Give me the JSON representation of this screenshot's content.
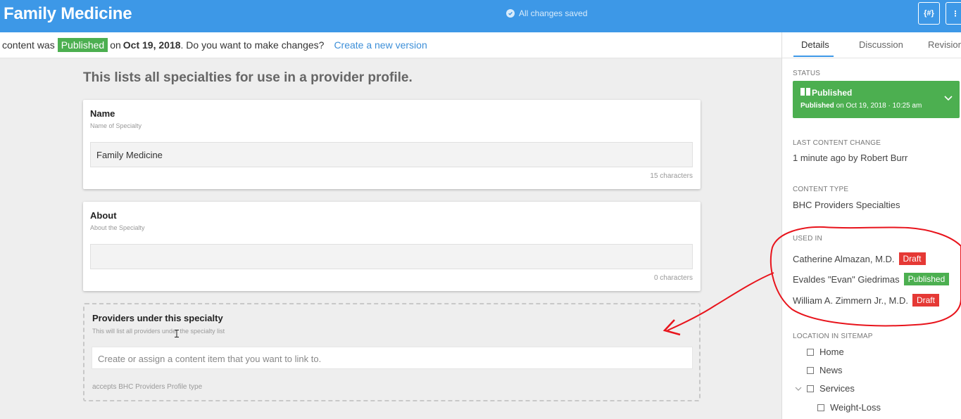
{
  "header": {
    "title": "Family Medicine",
    "save_status": "All changes saved",
    "code_button": "{#}",
    "more_button": "⋮"
  },
  "notice": {
    "prefix": "content was",
    "status": "Published",
    "on_text": "on",
    "date": "Oct 19, 2018",
    "question": ". Do you want to make changes?",
    "link": "Create a new version"
  },
  "main": {
    "intro": "This lists all specialties for use in a provider profile.",
    "name_field": {
      "label": "Name",
      "hint": "Name of Specialty",
      "value": "Family Medicine",
      "count": "15 characters"
    },
    "about_field": {
      "label": "About",
      "hint": "About the Specialty",
      "value": "",
      "count": "0 characters"
    },
    "providers_field": {
      "label": "Providers under this specialty",
      "hint": "This will list all providers under the specialty list",
      "placeholder": "Create or assign a content item that you want to link to.",
      "accepts": "accepts BHC Providers Profile type"
    }
  },
  "sidebar": {
    "tabs": [
      "Details",
      "Discussion",
      "Revision"
    ],
    "status": {
      "heading": "STATUS",
      "title": "Published",
      "sub_prefix": "Published",
      "sub_rest": "on Oct 19, 2018 · 10:25 am"
    },
    "last_change": {
      "heading": "LAST CONTENT CHANGE",
      "value": "1 minute ago by Robert Burr"
    },
    "content_type": {
      "heading": "CONTENT TYPE",
      "value": "BHC Providers Specialties"
    },
    "used_in": {
      "heading": "USED IN",
      "items": [
        {
          "name": "Catherine Almazan, M.D.",
          "status": "Draft"
        },
        {
          "name": "Evaldes \"Evan\" Giedrimas",
          "status": "Published"
        },
        {
          "name": "William A. Zimmern Jr., M.D.",
          "status": "Draft"
        }
      ]
    },
    "sitemap": {
      "heading": "LOCATION IN SITEMAP",
      "items": [
        "Home",
        "News",
        "Services",
        "Weight-Loss"
      ]
    }
  },
  "colors": {
    "header_blue": "#3d98e7",
    "published_green": "#4caf50",
    "draft_red": "#e53935",
    "annotation_red": "#e8141c"
  }
}
